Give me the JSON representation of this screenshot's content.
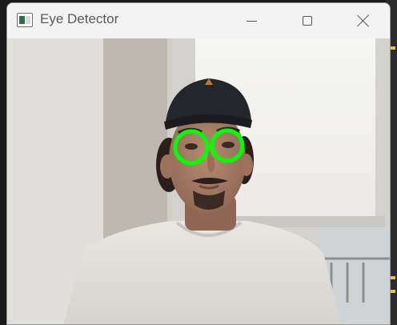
{
  "window": {
    "title": "Eye Detector",
    "controls": {
      "minimize": "minimize-icon",
      "maximize": "maximize-icon",
      "close": "close-icon"
    }
  },
  "video": {
    "detections_count": 2,
    "detection_color": "#00ff00"
  }
}
